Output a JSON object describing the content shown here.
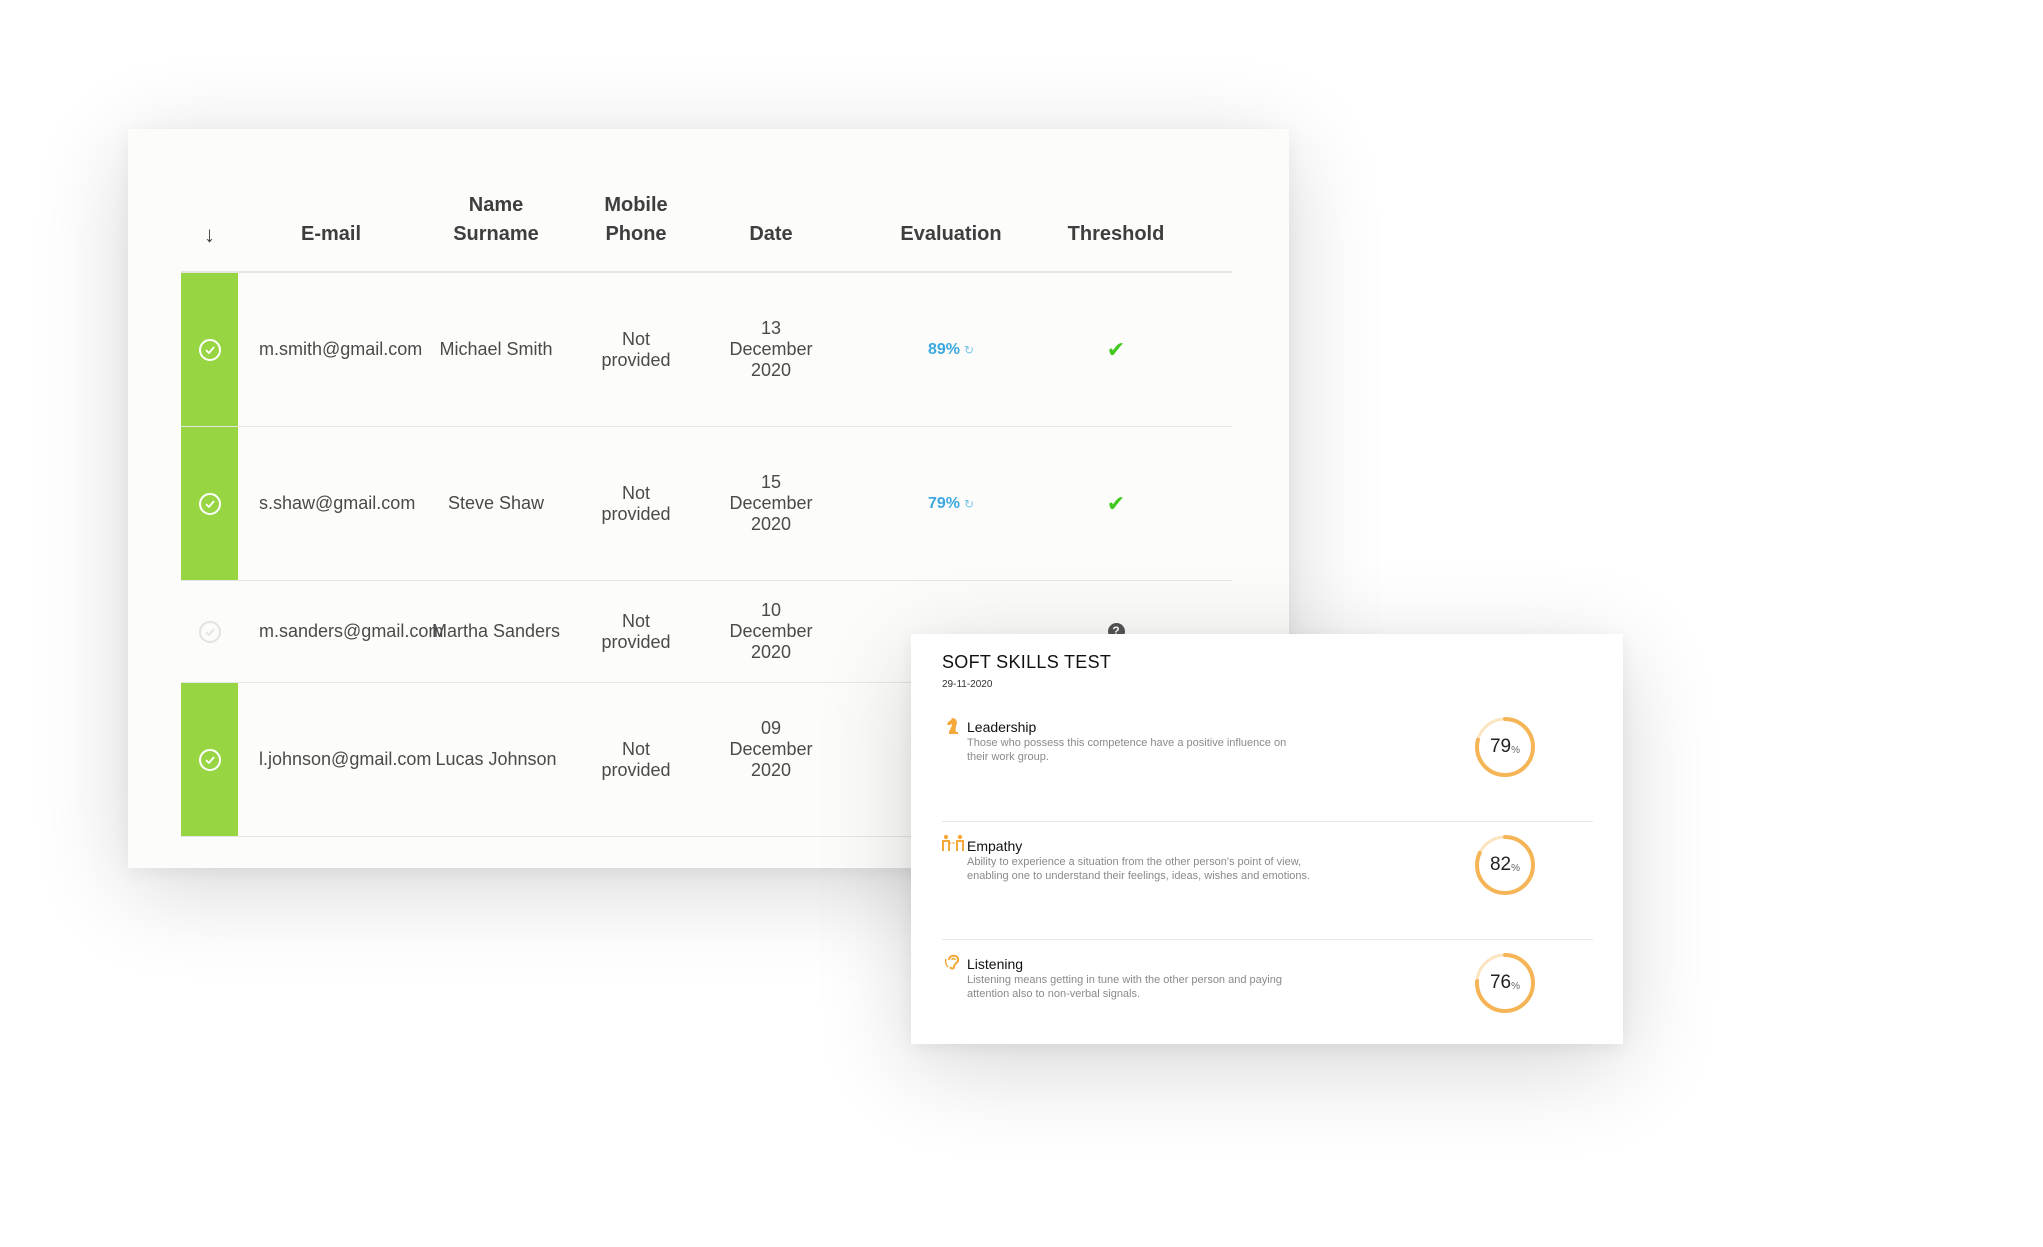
{
  "table": {
    "headers": {
      "sort_arrow": "↓",
      "email": "E-mail",
      "name_line1": "Name",
      "name_line2": "Surname",
      "mobile_line1": "Mobile",
      "mobile_line2": "Phone",
      "date": "Date",
      "evaluation": "Evaluation",
      "threshold": "Threshold"
    },
    "rows": [
      {
        "status": "passed",
        "email": "m.smith@gmail.com",
        "name": "Michael Smith",
        "phone_line1": "Not",
        "phone_line2": "provided",
        "date_day": "13",
        "date_month": "December",
        "date_year": "2020",
        "evaluation": "89%",
        "threshold": "check"
      },
      {
        "status": "passed",
        "email": "s.shaw@gmail.com",
        "name": "Steve Shaw",
        "phone_line1": "Not",
        "phone_line2": "provided",
        "date_day": "15",
        "date_month": "December",
        "date_year": "2020",
        "evaluation": "79%",
        "threshold": "check"
      },
      {
        "status": "pending",
        "email": "m.sanders@gmail.com",
        "name": "Martha Sanders",
        "phone_line1": "Not",
        "phone_line2": "provided",
        "date_day": "10",
        "date_month": "December",
        "date_year": "2020",
        "evaluation": "",
        "threshold": "unknown"
      },
      {
        "status": "passed",
        "email": "l.johnson@gmail.com",
        "name": "Lucas Johnson",
        "phone_line1": "Not",
        "phone_line2": "provided",
        "date_day": "09",
        "date_month": "December",
        "date_year": "2020",
        "evaluation": "",
        "threshold": ""
      }
    ]
  },
  "skills": {
    "title": "SOFT SKILLS TEST",
    "date": "29-11-2020",
    "items": [
      {
        "name": "Leadership",
        "desc_line1": "Those who possess this competence have a positive influence on",
        "desc_line2": "their work group.",
        "value": "79",
        "fraction": 0.79,
        "icon": "chess-knight-icon"
      },
      {
        "name": "Empathy",
        "desc_line1": "Ability to experience a situation from the other person's point of view,",
        "desc_line2": "enabling one to understand their feelings, ideas, wishes and emotions.",
        "value": "82",
        "fraction": 0.82,
        "icon": "people-icon"
      },
      {
        "name": "Listening",
        "desc_line1": "Listening means getting in tune with the other person and paying",
        "desc_line2": "attention also to non-verbal signals.",
        "value": "76",
        "fraction": 0.76,
        "icon": "ear-icon"
      }
    ],
    "percent_symbol": "%"
  },
  "colors": {
    "pass_green": "#97d543",
    "eval_blue": "#3ba9e0",
    "gauge_orange": "#f5b455",
    "tick_green": "#42c91e"
  }
}
